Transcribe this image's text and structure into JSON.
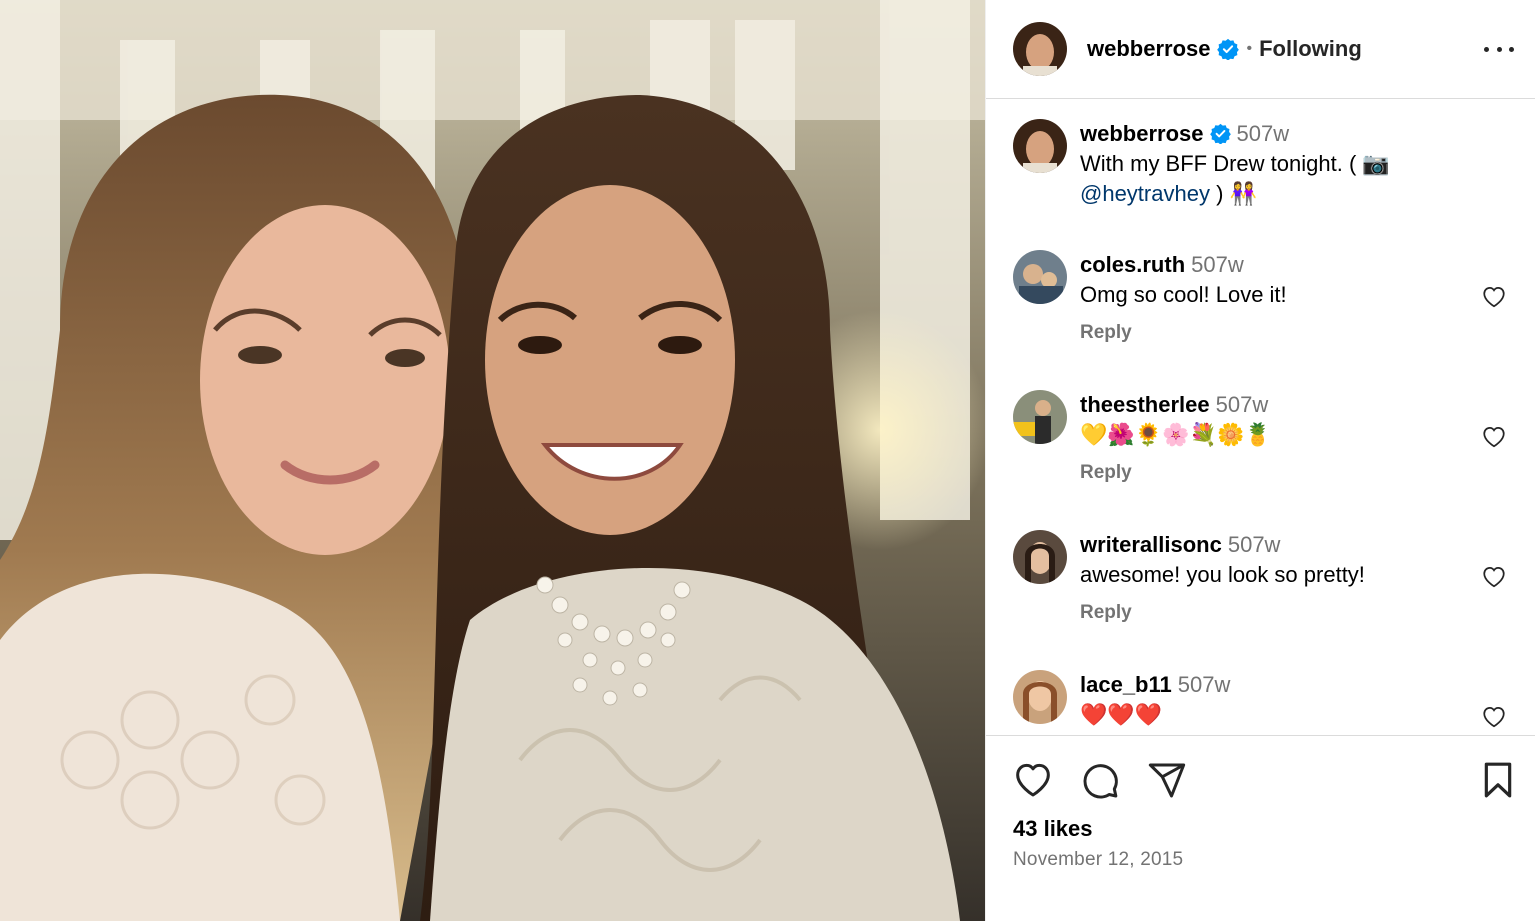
{
  "photo": {
    "alt_name": "post-photo"
  },
  "header": {
    "username": "webberrose",
    "separator": "•",
    "follow_status": "Following"
  },
  "caption": {
    "username": "webberrose",
    "time": "507w",
    "text_prefix": "With my BFF Drew tonight. ( 📷",
    "mention": "@heytravhey",
    "text_suffix": ") 👭"
  },
  "comments": [
    {
      "username": "coles.ruth",
      "time": "507w",
      "text": "Omg so cool! Love it!",
      "reply": "Reply"
    },
    {
      "username": "theestherlee",
      "time": "507w",
      "text": "💛🌺🌻🌸💐🌼🍍",
      "reply": "Reply"
    },
    {
      "username": "writerallisonc",
      "time": "507w",
      "text": "awesome! you look so pretty!",
      "reply": "Reply"
    },
    {
      "username": "lace_b11",
      "time": "507w",
      "text": "❤️❤️❤️",
      "reply": ""
    }
  ],
  "actions": {
    "likes": "43 likes",
    "date": "November 12, 2015"
  },
  "colors": {
    "verified": "#0095f6",
    "mention": "#00376b",
    "muted": "#737373",
    "divider": "#dbdbdb"
  },
  "icons": [
    "verified-badge-icon",
    "more-options-icon",
    "heart-icon",
    "comment-icon",
    "share-icon",
    "bookmark-icon"
  ]
}
